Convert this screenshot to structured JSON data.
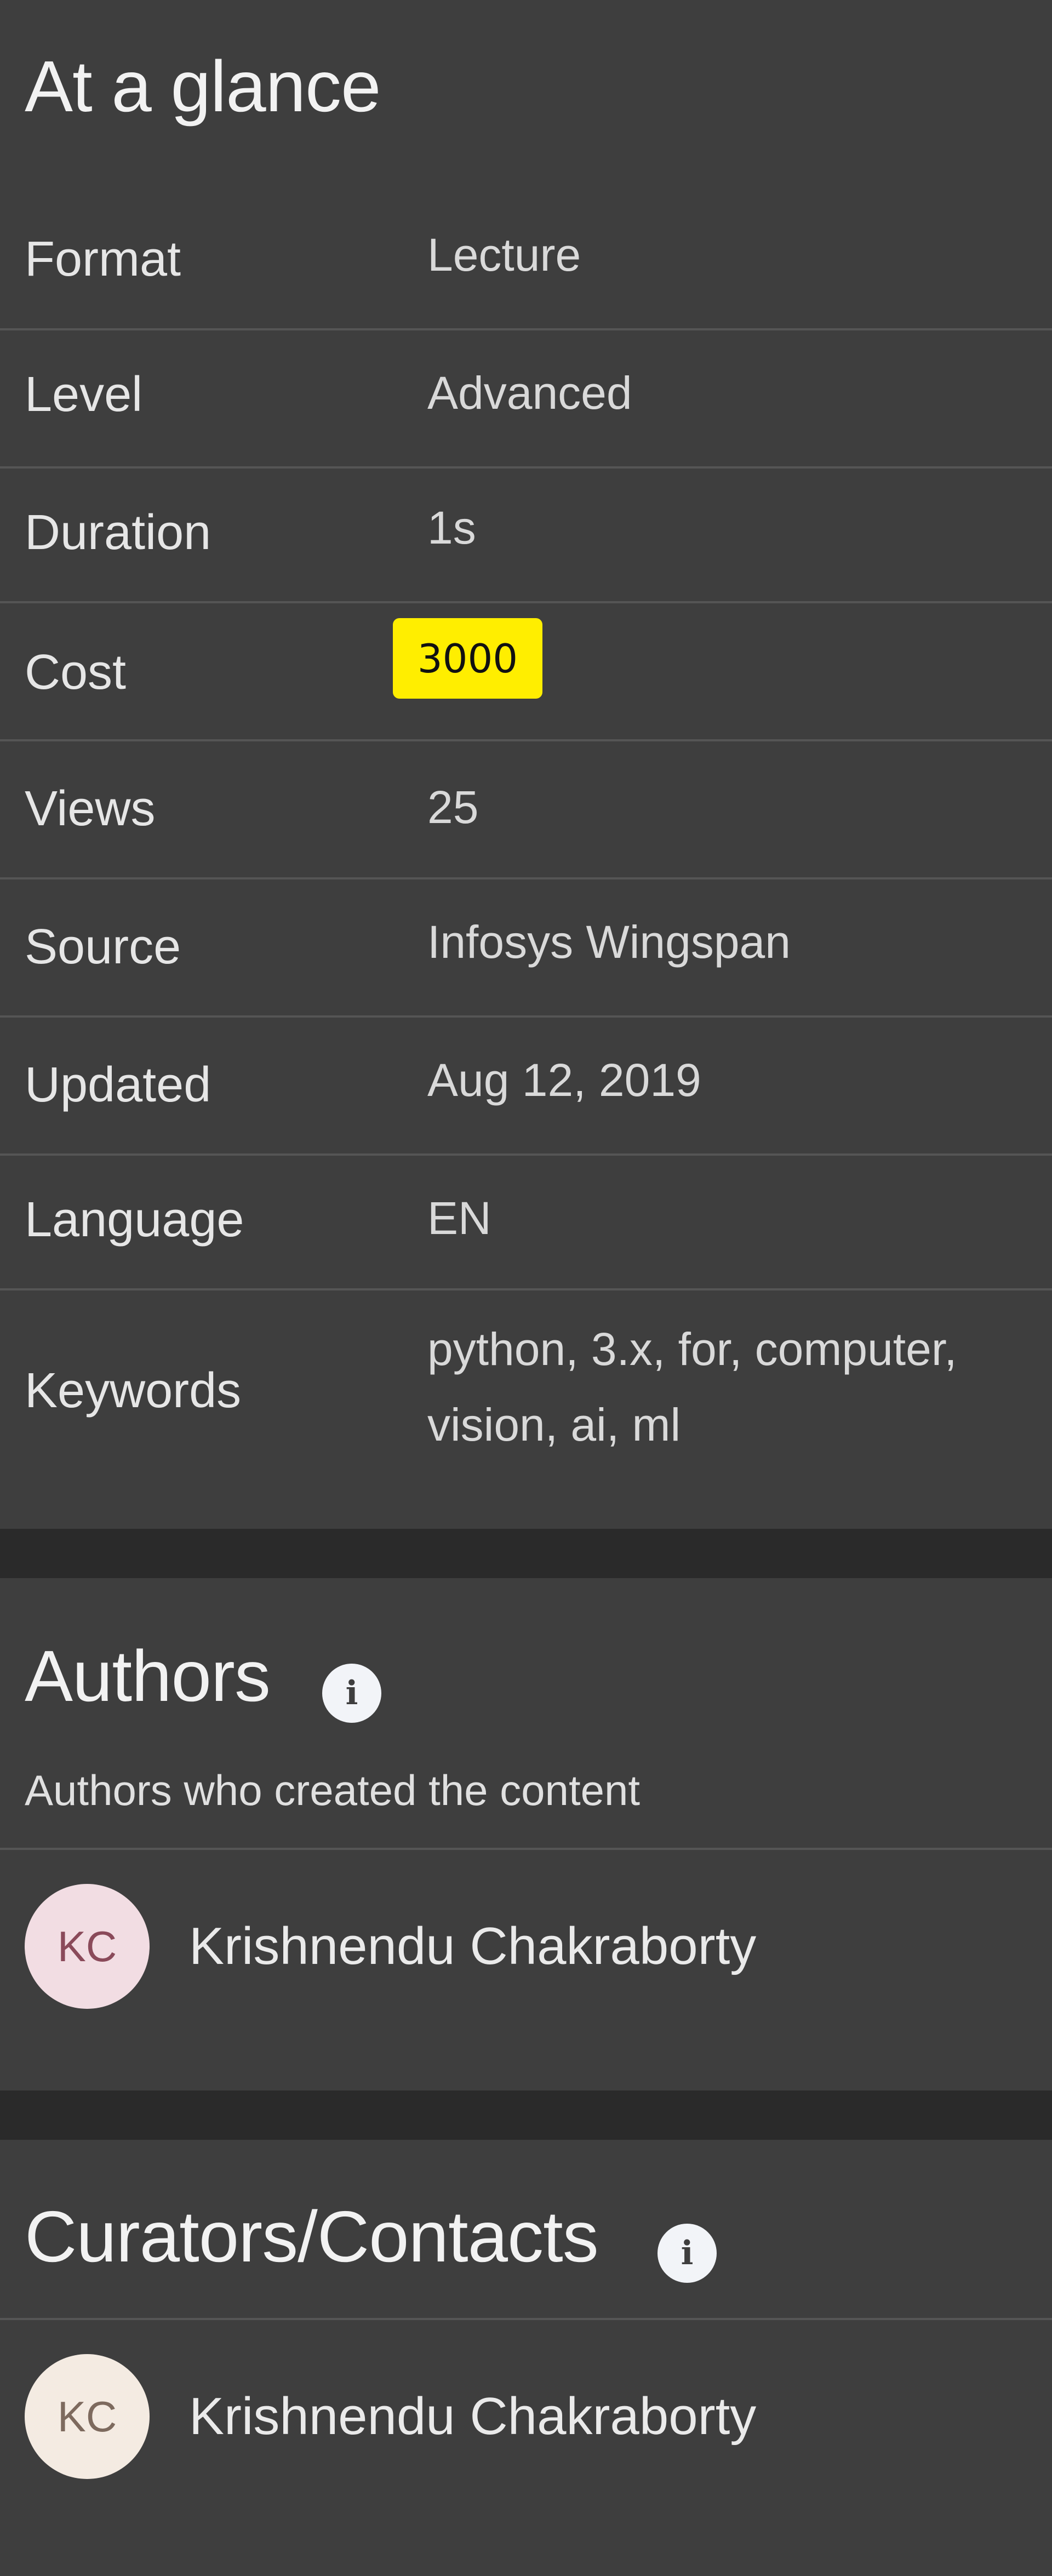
{
  "at_a_glance": {
    "title": "At a glance",
    "rows": [
      {
        "label": "Format",
        "value": "Lecture"
      },
      {
        "label": "Level",
        "value": "Advanced"
      },
      {
        "label": "Duration",
        "value": "1s"
      },
      {
        "label": "Cost",
        "value": "3000"
      },
      {
        "label": "Views",
        "value": "25"
      },
      {
        "label": "Source",
        "value": "Infosys Wingspan"
      },
      {
        "label": "Updated",
        "value": "Aug 12, 2019"
      },
      {
        "label": "Language",
        "value": "EN"
      },
      {
        "label": "Keywords",
        "value": "python, 3.x, for, computer, vision, ai, ml"
      }
    ]
  },
  "authors": {
    "title": "Authors",
    "subtitle": "Authors who created the content",
    "people": [
      {
        "initials": "KC",
        "name": "Krishnendu Chakraborty"
      }
    ]
  },
  "curators": {
    "title": "Curators/Contacts",
    "people": [
      {
        "initials": "KC",
        "name": "Krishnendu Chakraborty"
      }
    ]
  },
  "colors": {
    "card_background": "#3e3e3e",
    "page_background": "#2a2a2a",
    "cost_badge": "#ffee00"
  }
}
